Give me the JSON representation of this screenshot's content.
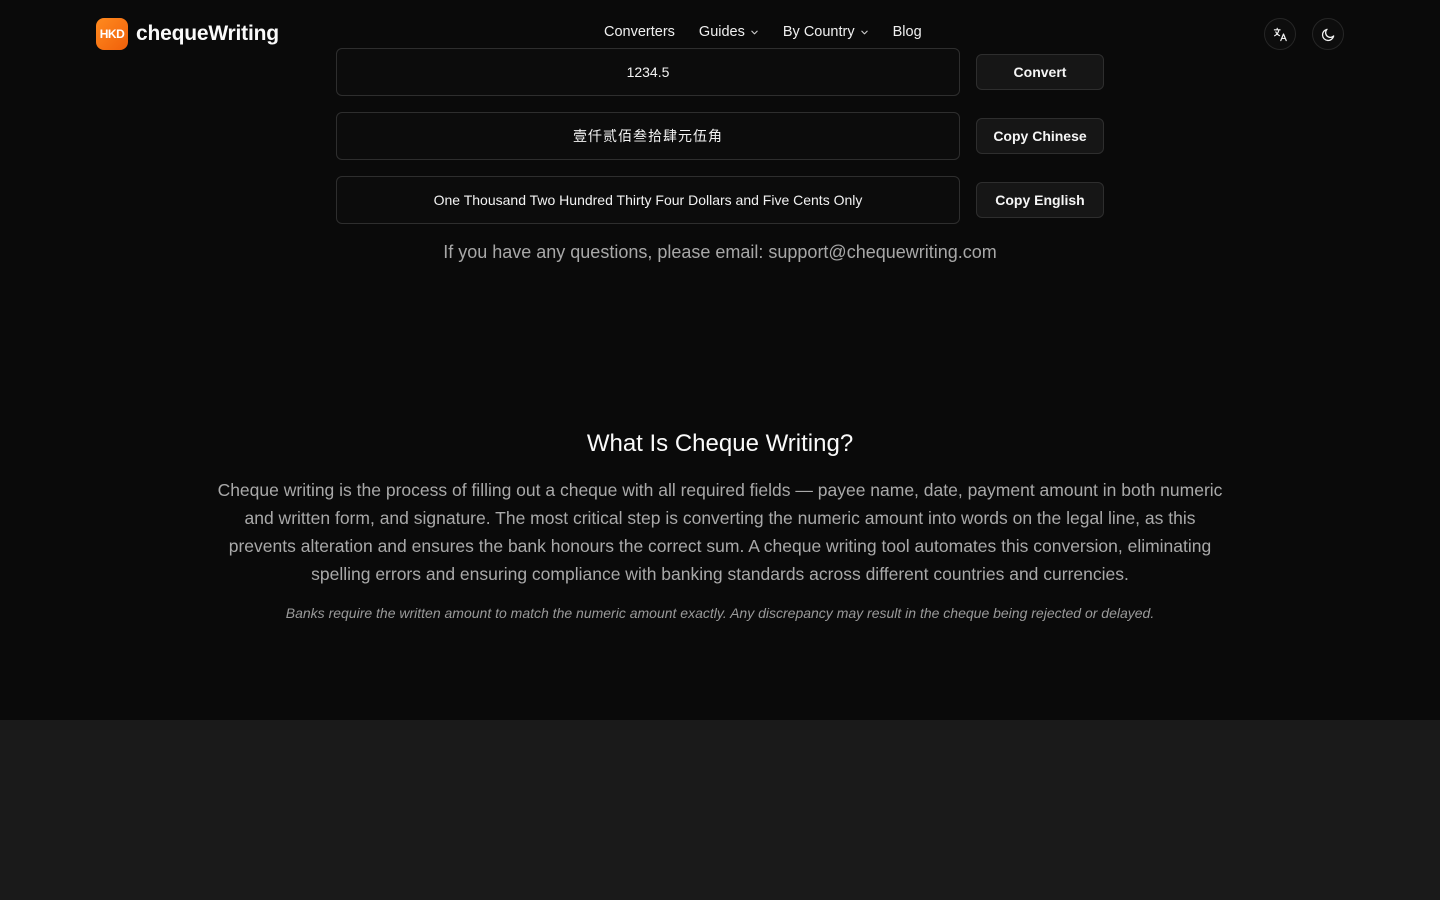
{
  "header": {
    "logo_text": "HKD",
    "brand_name": "chequeWriting",
    "nav": [
      {
        "label": "Converters",
        "has_dropdown": false
      },
      {
        "label": "Guides",
        "has_dropdown": true
      },
      {
        "label": "By Country",
        "has_dropdown": true
      },
      {
        "label": "Blog",
        "has_dropdown": false
      }
    ],
    "icons": [
      "translate-icon",
      "moon-icon"
    ]
  },
  "converter": {
    "amount_value": "1234.5",
    "convert_label": "Convert",
    "chinese_result": "壹仟贰佰叁拾肆元伍角",
    "copy_chinese_label": "Copy Chinese",
    "english_result": "One Thousand Two Hundred Thirty Four Dollars and Five Cents Only",
    "copy_english_label": "Copy English"
  },
  "support_text": "If you have any questions, please email: support@chequewriting.com",
  "about": {
    "title": "What Is Cheque Writing?",
    "body": "Cheque writing is the process of filling out a cheque with all required fields — payee name, date, payment amount in both numeric and written form, and signature. The most critical step is converting the numeric amount into words on the legal line, as this prevents alteration and ensures the bank honours the correct sum. A cheque writing tool automates this conversion, eliminating spelling errors and ensuring compliance with banking standards across different countries and currencies.",
    "note": "Banks require the written amount to match the numeric amount exactly. Any discrepancy may result in the cheque being rejected or delayed."
  },
  "colors": {
    "background": "#0a0a0a",
    "accent": "#f47216",
    "footer": "#1a1a1a"
  }
}
